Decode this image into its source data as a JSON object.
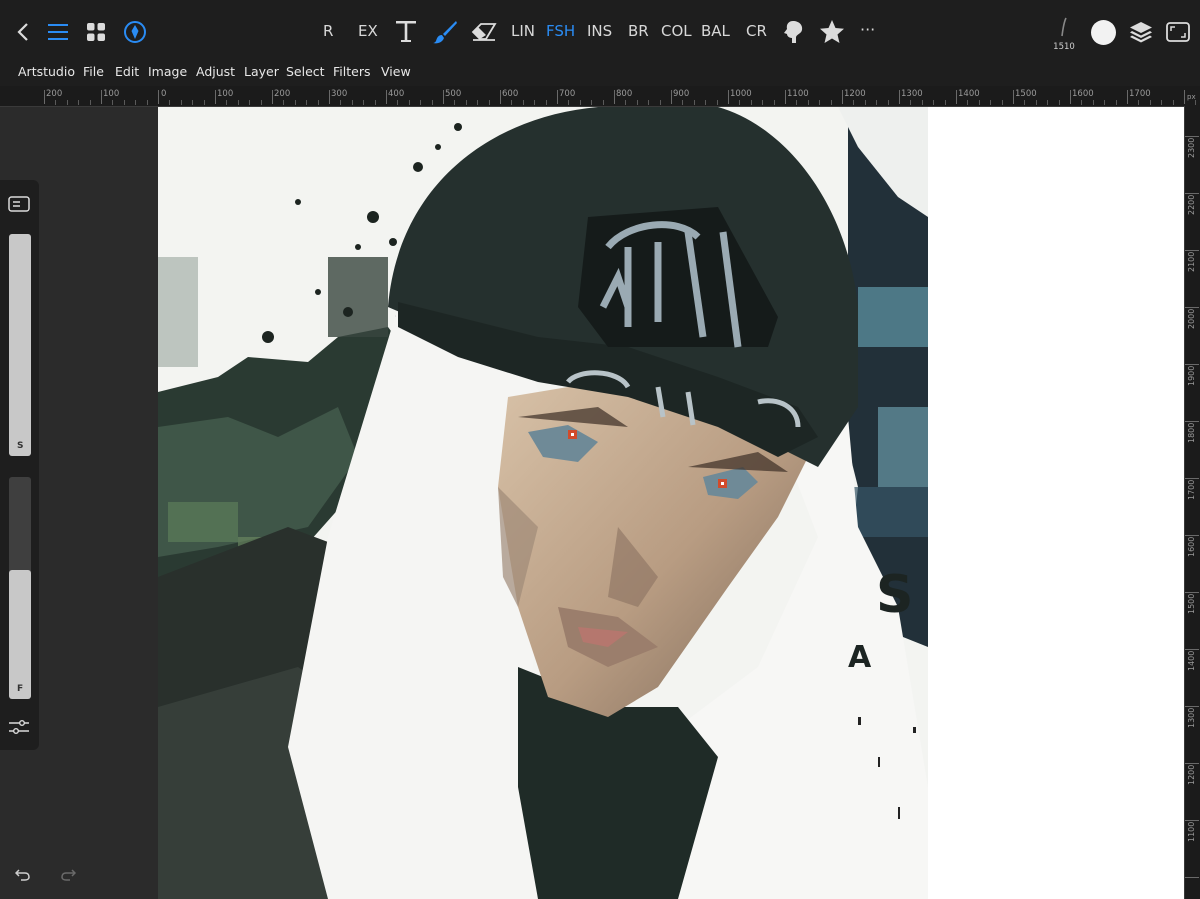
{
  "toolbar": {
    "tools": [
      {
        "label": "R",
        "active": false
      },
      {
        "label": "EX",
        "active": false
      },
      {
        "label": "LIN",
        "active": false
      },
      {
        "label": "FSH",
        "active": true
      },
      {
        "label": "INS",
        "active": false
      },
      {
        "label": "BR",
        "active": false
      },
      {
        "label": "COL",
        "active": false
      },
      {
        "label": "BAL",
        "active": false
      },
      {
        "label": "CR",
        "active": false
      }
    ],
    "brush_size": "1510",
    "more_label": "···",
    "accent_color": "#2a8cf4"
  },
  "menu": [
    "Artstudio",
    "File",
    "Edit",
    "Image",
    "Adjust",
    "Layer",
    "Select",
    "Filters",
    "View"
  ],
  "ruler": {
    "horizontal_labels": [
      "200",
      "100",
      "0",
      "100",
      "200",
      "300",
      "400",
      "500",
      "600",
      "700",
      "800",
      "900",
      "1000",
      "1100",
      "1200",
      "1300",
      "1400",
      "1500",
      "1600",
      "1700"
    ],
    "unit": "px",
    "vertical_labels": [
      "2300",
      "2200",
      "2100",
      "2000",
      "1900",
      "1800",
      "1700",
      "1600",
      "1500",
      "1400",
      "1300",
      "1200",
      "1100"
    ]
  },
  "sidepanel": {
    "size_label": "S",
    "flow_label": "F",
    "size_level": 1.0,
    "flow_level": 0.58
  }
}
